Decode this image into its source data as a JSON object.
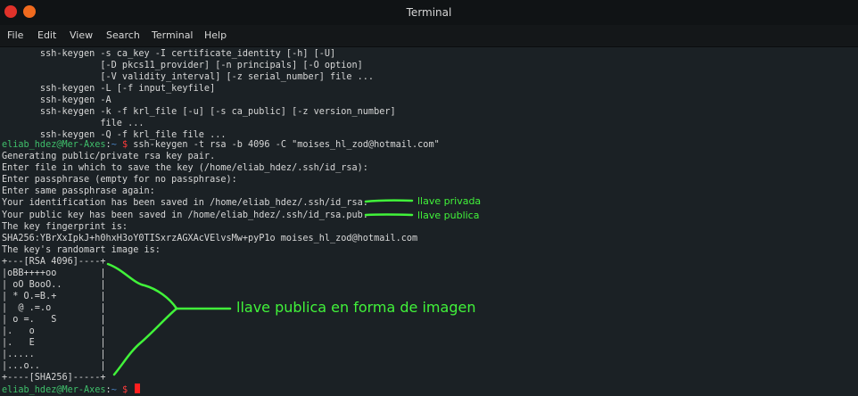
{
  "window": {
    "title": "Terminal"
  },
  "menu": [
    "File",
    "Edit",
    "View",
    "Search",
    "Terminal",
    "Help"
  ],
  "terminal": {
    "lines": [
      "       ssh-keygen -s ca_key -I certificate_identity [-h] [-U]",
      "                  [-D pkcs11_provider] [-n principals] [-O option]",
      "                  [-V validity_interval] [-z serial_number] file ...",
      "       ssh-keygen -L [-f input_keyfile]",
      "       ssh-keygen -A",
      "       ssh-keygen -k -f krl_file [-u] [-s ca_public] [-z version_number]",
      "                  file ...",
      "       ssh-keygen -Q -f krl_file file ...",
      null,
      "Generating public/private rsa key pair.",
      "Enter file in which to save the key (/home/eliab_hdez/.ssh/id_rsa):",
      "Enter passphrase (empty for no passphrase):",
      "Enter same passphrase again:",
      "Your identification has been saved in /home/eliab_hdez/.ssh/id_rsa.",
      "Your public key has been saved in /home/eliab_hdez/.ssh/id_rsa.pub.",
      "The key fingerprint is:",
      "SHA256:YBrXxIpkJ+h0hxH3oY0TISxrzAGXAcVElvsMw+pyP1o moises_hl_zod@hotmail.com",
      "The key's randomart image is:",
      "+---[RSA 4096]----+",
      "|oBB++++oo        |",
      "| oO BooO..       |",
      "| * O.=B.+        |",
      "|  @ .=.o         |",
      "| o =.   S        |",
      "|.   o            |",
      "|.   E            |",
      "|.....            |",
      "|...o..           |",
      "+----[SHA256]-----+"
    ],
    "prompt": {
      "user_host": "eliab_hdez@Mer-Axes",
      "separator": ":",
      "path": "~",
      "dollar": " $ "
    },
    "command": "ssh-keygen -t rsa -b 4096 -C \"moises_hl_zod@hotmail.com\"",
    "last_prompt": {
      "user_host": "eliab_hdez@Mer-Axes",
      "separator": ":",
      "path": "~",
      "dollar": " $ "
    }
  },
  "annotations": {
    "private_key": "llave privada",
    "public_key": "llave publica",
    "public_key_image": "llave publica en forma de imagen"
  },
  "colors": {
    "annotation": "#41f33a",
    "prompt_user": "#3fbf6b",
    "prompt_path": "#4a86c7",
    "prompt_dollar": "#ff3b3b",
    "cursor": "#ff1f1f"
  }
}
